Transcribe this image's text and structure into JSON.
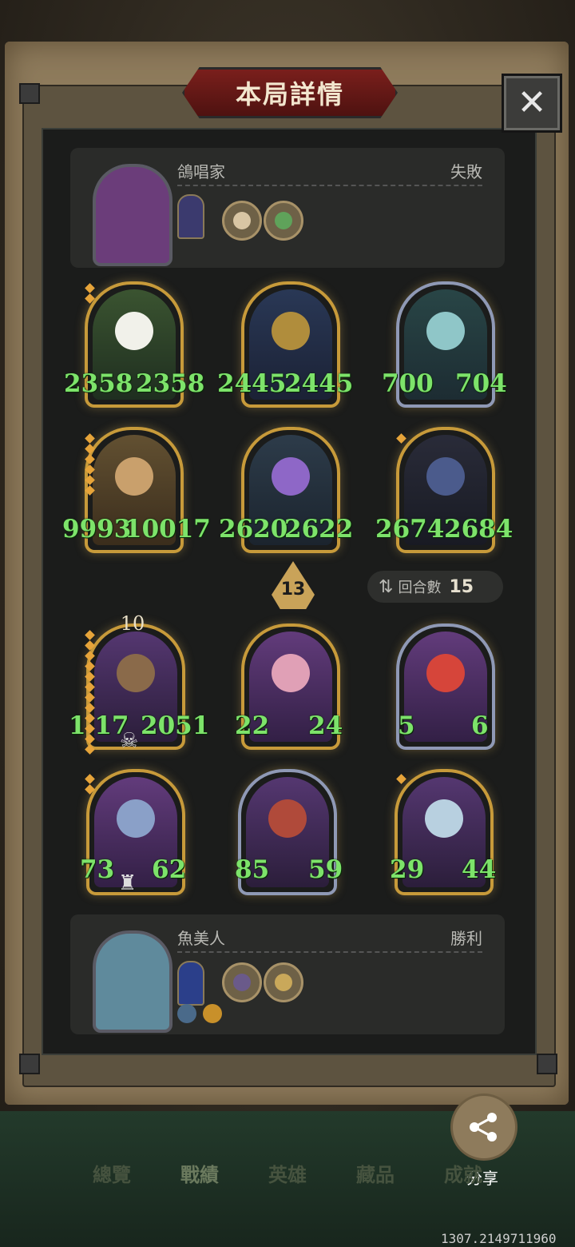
{
  "title": "本局詳情",
  "close_symbol": "✕",
  "opponent": {
    "name": "鴿唱家",
    "result": "失敗"
  },
  "player": {
    "name": "魚美人",
    "result": "勝利"
  },
  "opponent_level": "10",
  "turn": {
    "number": "13"
  },
  "rounds": {
    "icon": "⇅",
    "label": "回合數",
    "value": "15"
  },
  "opponent_board": [
    {
      "attack": "2358",
      "health": "2358"
    },
    {
      "attack": "2445",
      "health": "2445"
    },
    {
      "attack": "700",
      "health": "704"
    },
    {
      "attack": "9993",
      "health": "10017"
    },
    {
      "attack": "2620",
      "health": "2622"
    },
    {
      "attack": "2674",
      "health": "2684"
    }
  ],
  "player_board": [
    {
      "attack": "1 17",
      "health": "2051"
    },
    {
      "attack": "22",
      "health": "24"
    },
    {
      "attack": "5",
      "health": "6"
    },
    {
      "attack": "73",
      "health": "62"
    },
    {
      "attack": "85",
      "health": "59"
    },
    {
      "attack": "29",
      "health": "44"
    }
  ],
  "share_label": "分享",
  "tabs": [
    "總覽",
    "戰績",
    "英雄",
    "藏品",
    "成就"
  ],
  "coords_text": "1307.2149711960",
  "colors": {
    "stat_green": "#7de36a",
    "gold_frame": "#c79a3a",
    "panel": "#1b1c1b"
  }
}
